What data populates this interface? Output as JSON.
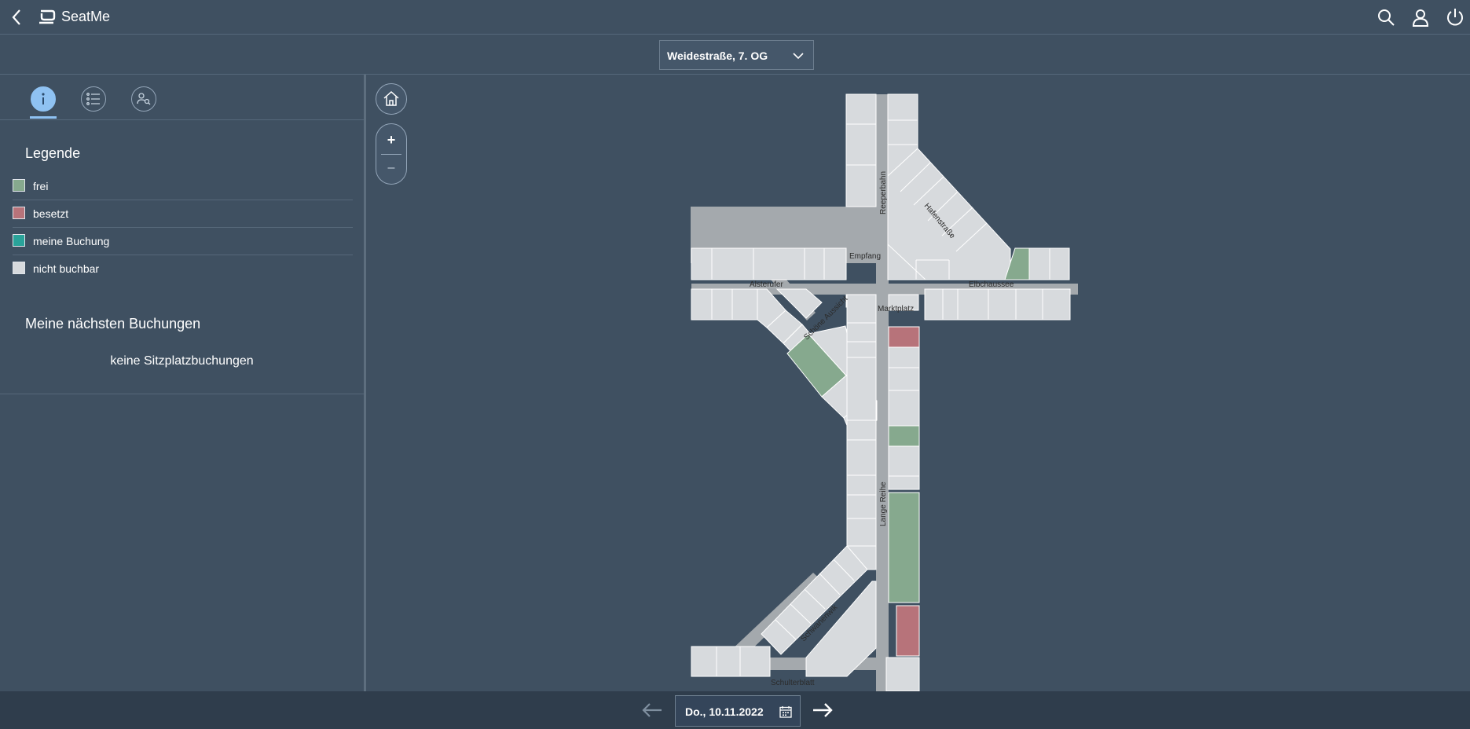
{
  "app": {
    "title": "SeatMe"
  },
  "location": {
    "selected": "Weidestraße, 7. OG"
  },
  "sidebar": {
    "legend_title": "Legende",
    "legend": [
      {
        "label": "frei",
        "color": "#86a98e"
      },
      {
        "label": "besetzt",
        "color": "#b7737a"
      },
      {
        "label": "meine Buchung",
        "color": "#2aa39a"
      },
      {
        "label": "nicht buchbar",
        "color": "#d7dadd"
      }
    ],
    "bookings_title": "Meine nächsten Buchungen",
    "no_bookings": "keine Sitzplatzbuchungen"
  },
  "map": {
    "zoom_in": "+",
    "zoom_out": "–",
    "labels": {
      "reeperbahn": "Reeperbahn",
      "hafenstrasse": "Hafenstraße",
      "empfang": "Empfang",
      "alsterufer": "Alsterufer",
      "elbchaussee": "Elbchaussee",
      "schoene_aussicht": "Schöne Aussicht",
      "marktplatz": "Marktplatz",
      "lange_reihe": "Lange Reihe",
      "schwanenwik": "Schwanenwik",
      "schulterblatt": "Schulterblatt"
    }
  },
  "footer": {
    "date": "Do., 10.11.2022"
  },
  "colors": {
    "free": "#86a98e",
    "occupied": "#b7737a",
    "mine": "#2aa39a",
    "unavailable": "#d7dadd",
    "accent": "#8fc2f2"
  }
}
